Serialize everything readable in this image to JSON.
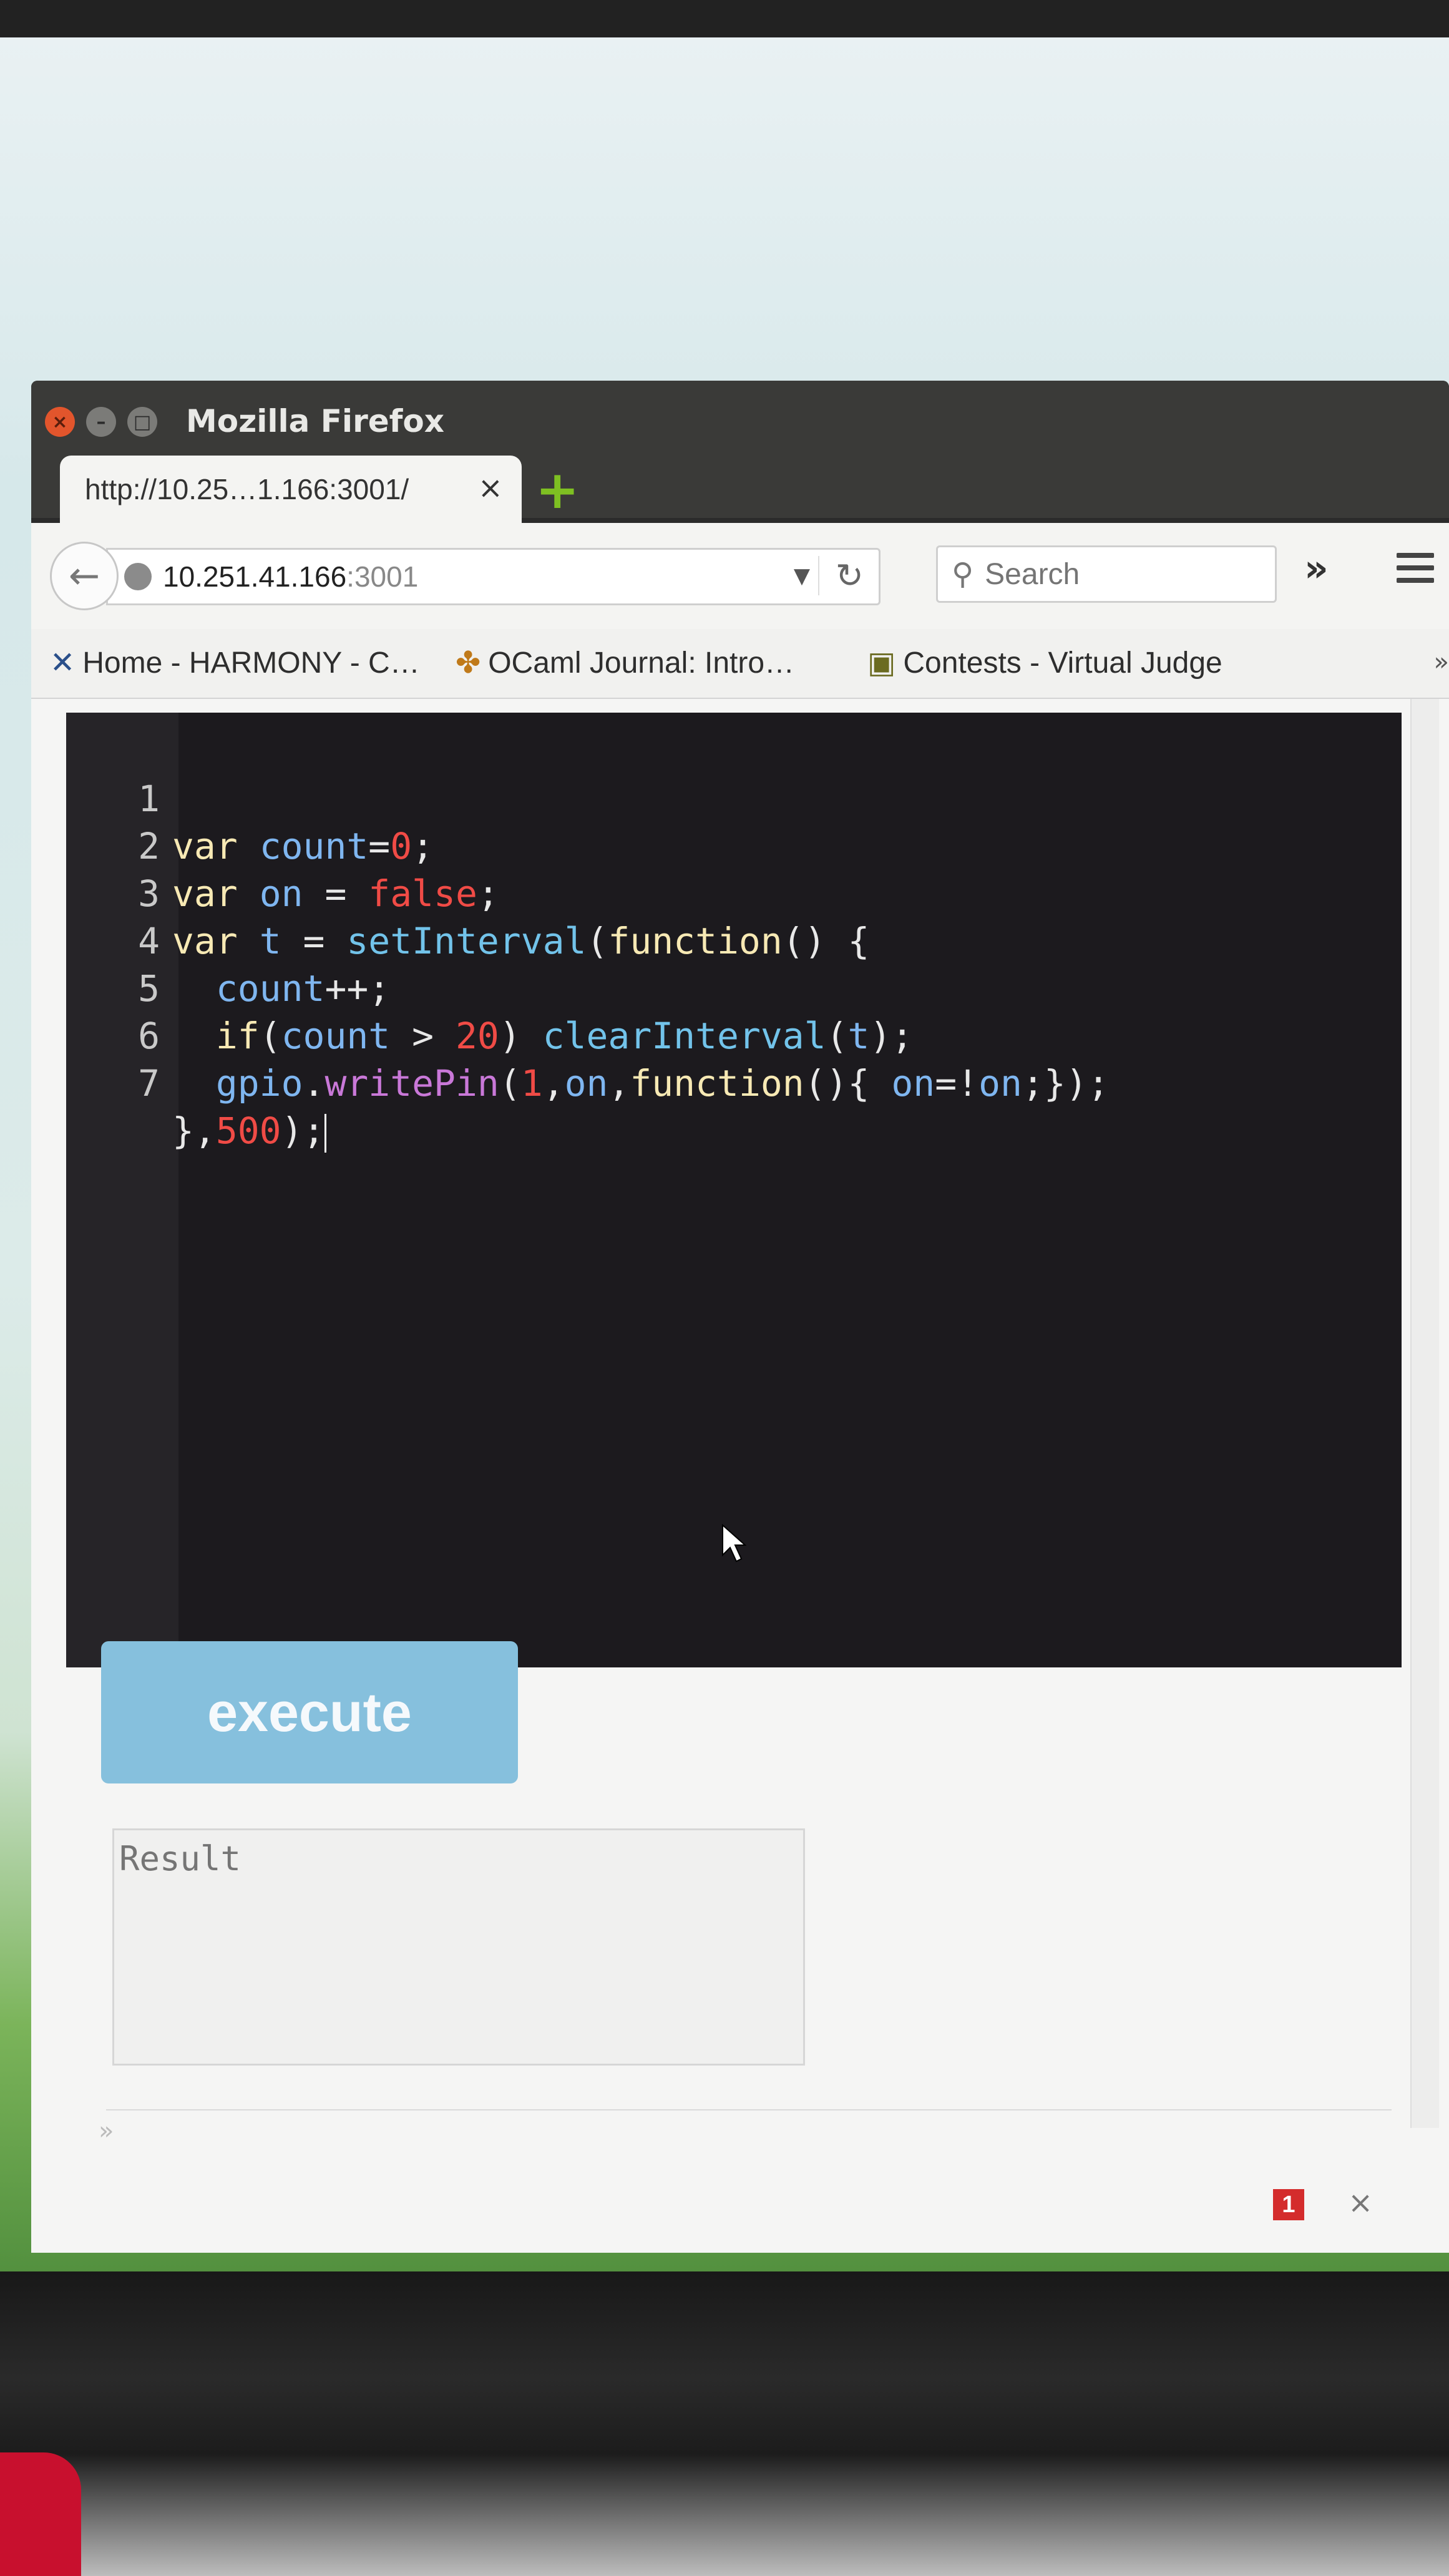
{
  "window": {
    "title": "Mozilla Firefox"
  },
  "tab": {
    "label": "http://10.25…1.166:3001/",
    "close": "×",
    "new_tab": "+"
  },
  "navbar": {
    "url_host": "10.251.41.166",
    "url_port": ":3001",
    "search_placeholder": "Search",
    "overflow": "»"
  },
  "bookmarks": [
    {
      "icon": "harmony-icon",
      "label": "Home - HARMONY - C…"
    },
    {
      "icon": "ocaml-icon",
      "label": "OCaml Journal: Intro…"
    },
    {
      "icon": "virtual-judge-icon",
      "label": "Contests - Virtual Judge"
    }
  ],
  "editor": {
    "line_numbers": [
      "1",
      "2",
      "3",
      "4",
      "5",
      "6",
      "7"
    ],
    "lines": [
      "var count=0;",
      "var on = false;",
      "var t = setInterval(function() {",
      "  count++;",
      "  if(count > 20) clearInterval(t);",
      "  gpio.writePin(1,on,function(){ on=!on;});",
      "},500);"
    ]
  },
  "execute_label": "execute",
  "result_placeholder": "Result",
  "notification_count": "1",
  "colors": {
    "editor_bg": "#1c1a1e",
    "keyword": "#f7e9b4",
    "variable": "#7fb6f0",
    "number": "#f04b46",
    "function": "#72c3ea",
    "method": "#c978d8",
    "execute_button": "#86c0dd"
  }
}
